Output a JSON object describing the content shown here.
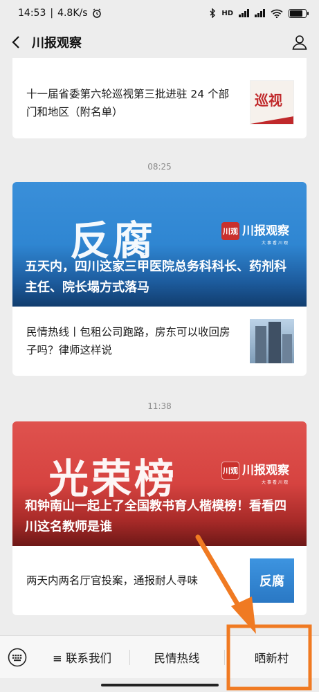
{
  "status": {
    "time": "14:53",
    "network_speed": "4.8K/s",
    "battery_level": 0.8
  },
  "nav": {
    "title": "川报观察"
  },
  "feed": {
    "top_item": {
      "text": "十一届省委第六轮巡视第三批进驻 24 个部门和地区（附名单）",
      "thumb_text": "巡视"
    },
    "time_1": "08:25",
    "group_1": {
      "hero_big_text": "反腐",
      "badge_text": "川观",
      "brand_name": "川报观察",
      "brand_sub": "大事看川观",
      "hero_title": "五天内，四川这家三甲医院总务科科长、药剂科主任、院长塌方式落马",
      "item_text": "民情热线丨包租公司跑路，房东可以收回房子吗？律师这样说"
    },
    "time_2": "11:38",
    "group_2": {
      "hero_big_text": "光荣榜",
      "badge_text": "川观",
      "brand_name": "川报观察",
      "brand_sub": "大事看川观",
      "hero_title": "和钟南山一起上了全国教书育人楷模榜！看看四川这名教师是谁",
      "item_text": "两天内两名厅官投案，通报耐人寻味",
      "thumb_text": "反腐"
    }
  },
  "bottom_menu": {
    "items": [
      "≡ 联系我们",
      "民情热线",
      "晒新村"
    ]
  },
  "colors": {
    "accent_orange": "#f07a22",
    "blue_hero": "#2f86d2",
    "red_hero": "#d64340"
  }
}
